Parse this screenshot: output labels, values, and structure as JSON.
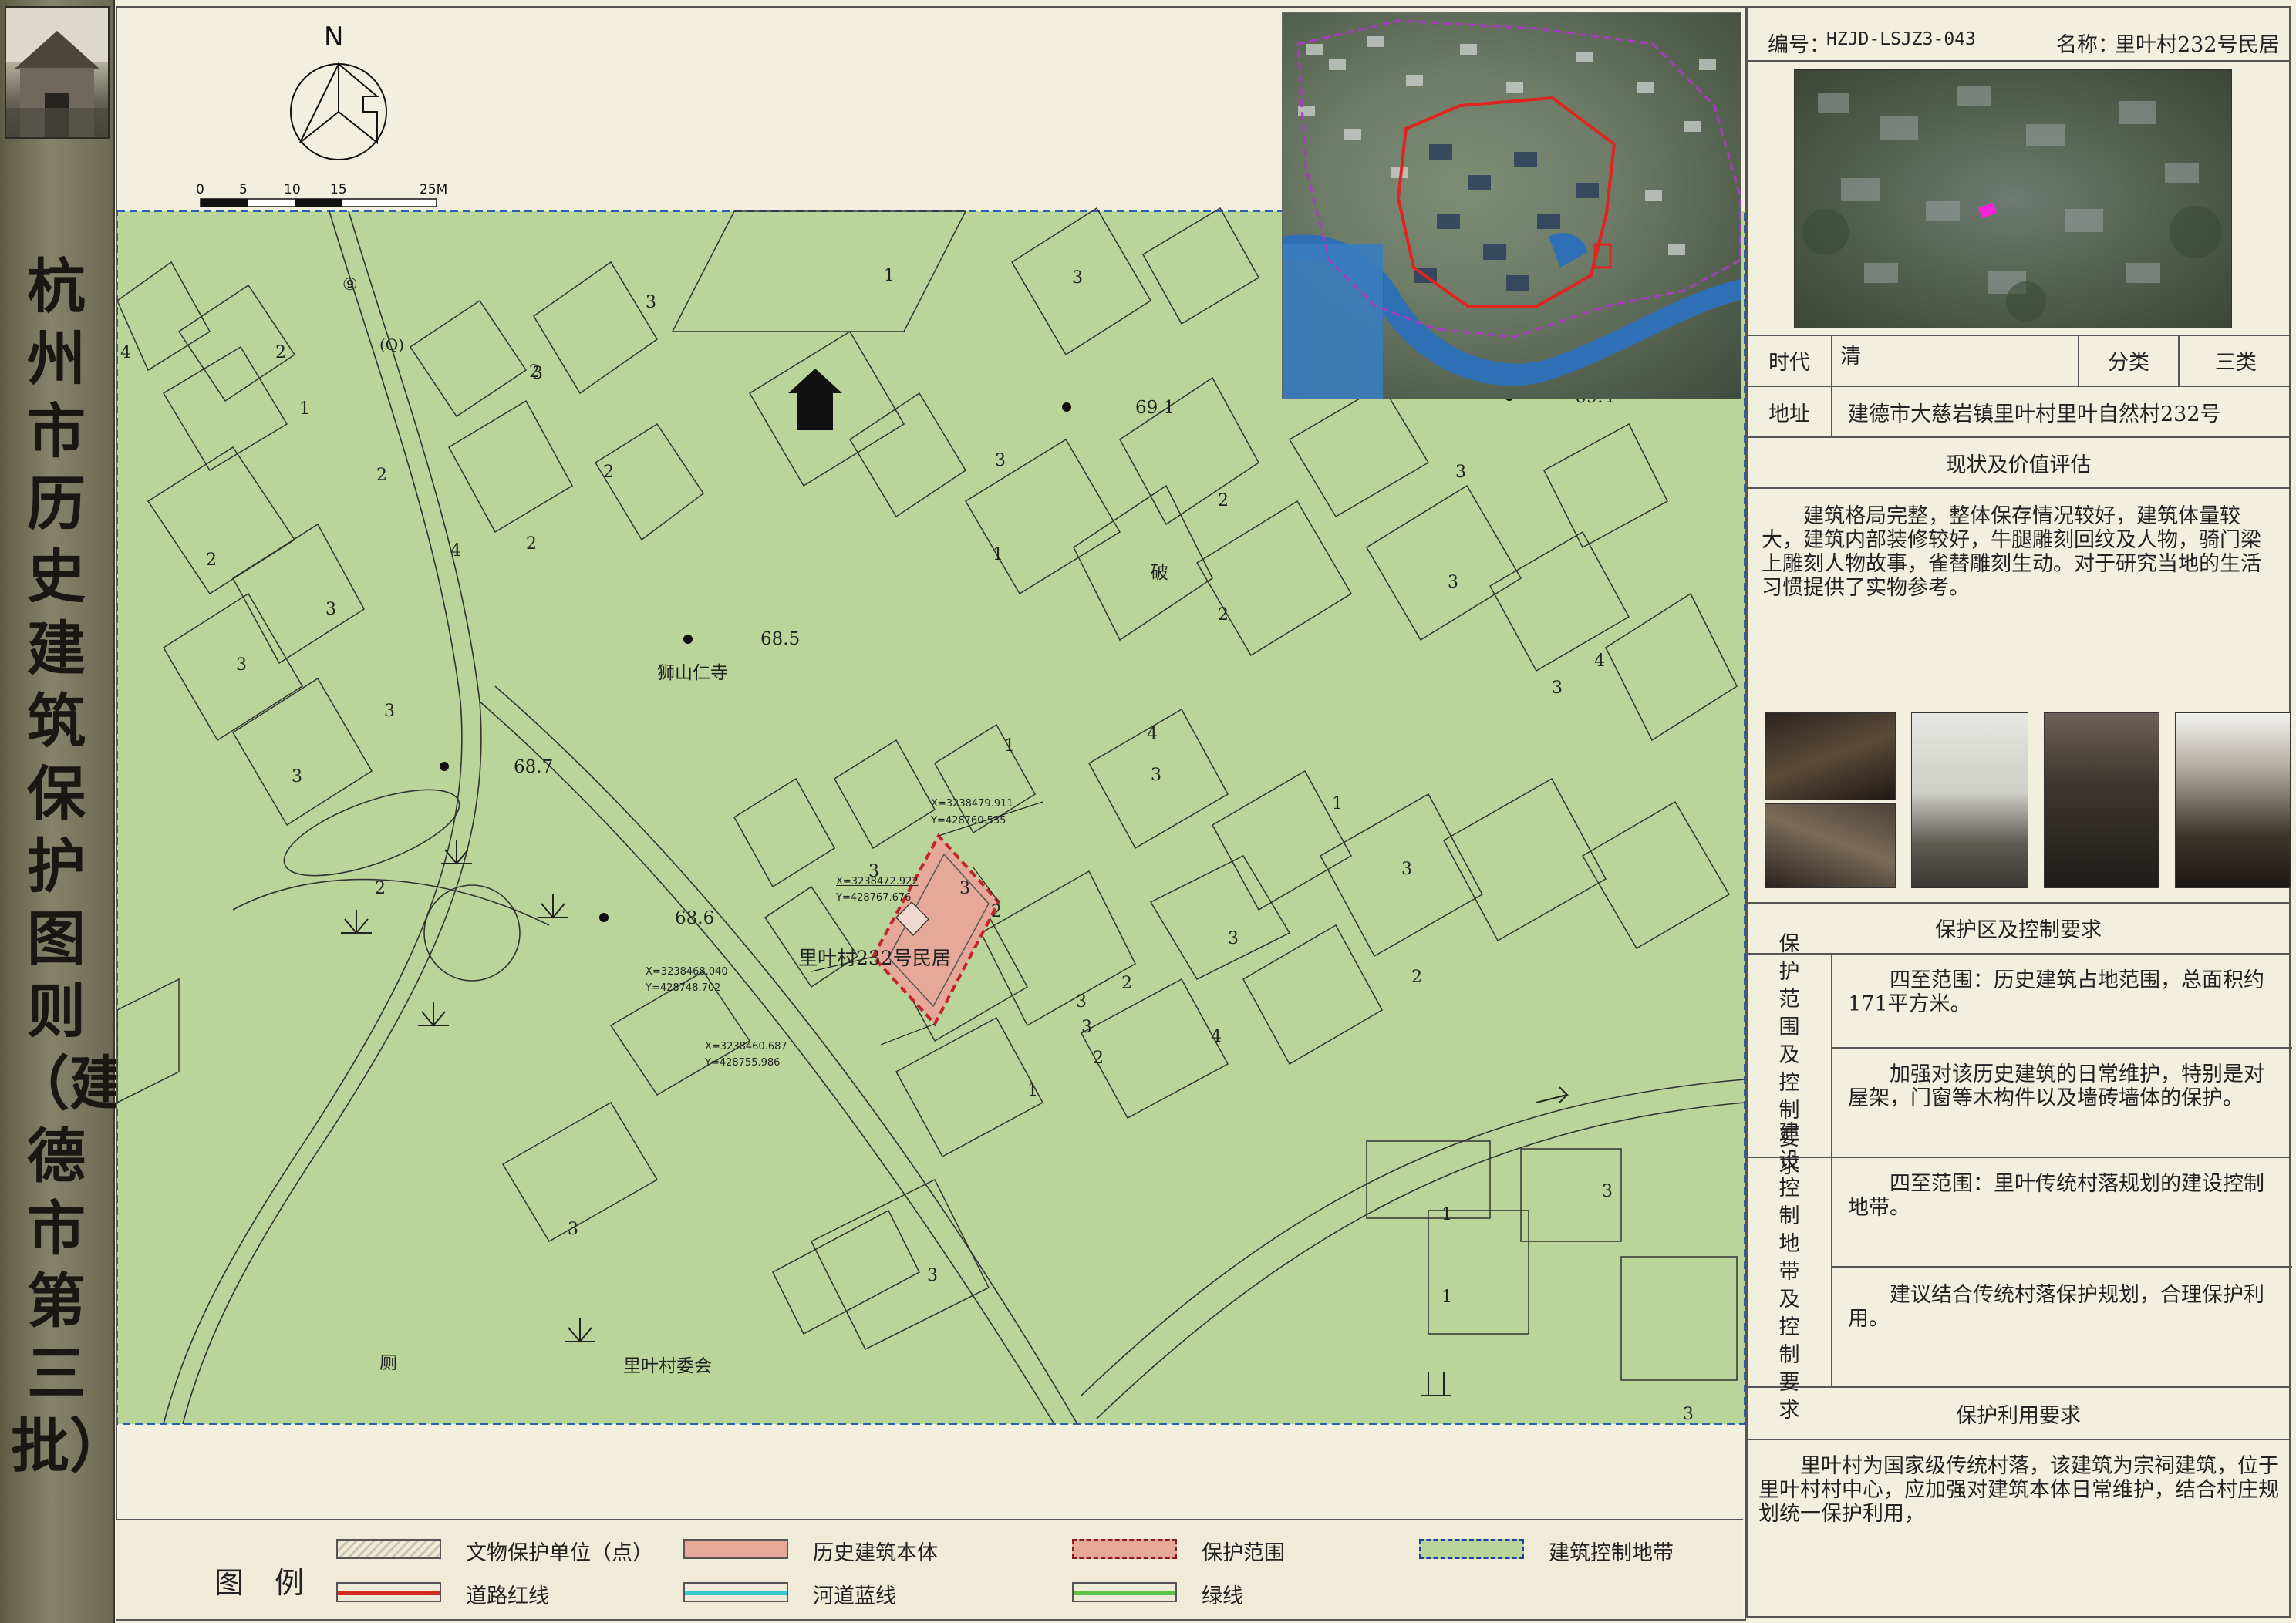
{
  "side_title": "杭州市历史建筑保护图则（建德市第三批）",
  "map": {
    "north": "N",
    "scale_ticks": [
      "0",
      "5",
      "10",
      "15",
      "25M"
    ],
    "main_building_label": "里叶村232号民居",
    "coords": [
      {
        "x": "X=3238479.911",
        "y": "Y=428760.535"
      },
      {
        "x": "X=3238472.922",
        "y": "Y=428767.676"
      },
      {
        "x": "X=3238468.040",
        "y": "Y=428748.702"
      },
      {
        "x": "X=3238460.687",
        "y": "Y=428755.986"
      }
    ],
    "place_labels": {
      "temple": "狮山仁寺",
      "village_committee": "里叶村委会",
      "broken": "破",
      "toilet": "厕"
    },
    "road_labels": [
      "⑨",
      "(Q)"
    ],
    "elevations": [
      "69.1",
      "68.5",
      "68.7",
      "68.6",
      "69.4"
    ],
    "building_floors": [
      "1",
      "2",
      "3",
      "4"
    ]
  },
  "legend": {
    "title": "图 例",
    "items": [
      {
        "label": "文物保护单位（点）",
        "color": "#c9c5b2"
      },
      {
        "label": "历史建筑本体",
        "color": "#e6a898"
      },
      {
        "label": "保护范围",
        "color": "#e6a898"
      },
      {
        "label": "建筑控制地带",
        "color": "#b9d59a"
      },
      {
        "label": "道路红线",
        "color": "#d42a24"
      },
      {
        "label": "河道蓝线",
        "color": "#36c9d4"
      },
      {
        "label": "绿线",
        "color": "#5bc446"
      }
    ]
  },
  "panel": {
    "code_label": "编号：",
    "code_value": "HZJD-LSJZ3-043",
    "name_label": "名称：",
    "name_value": "里叶村232号民居",
    "era_label": "时代",
    "era_value": "清",
    "class_label": "分类",
    "class_value": "三类",
    "address_label": "地址",
    "address_value": "建德市大慈岩镇里叶村里叶自然村232号",
    "status_heading": "现状及价值评估",
    "status_text": "建筑格局完整，整体保存情况较好，建筑体量较大，建筑内部装修较好，牛腿雕刻回纹及人物，骑门梁上雕刻人物故事，雀替雕刻生动。对于研究当地的生活习惯提供了实物参考。",
    "zone_heading": "保护区及控制要求",
    "protect_label": "保护范围及控制要求",
    "protect_range": "四至范围：历史建筑占地范围，总面积约171平方米。",
    "protect_req": "加强对该历史建筑的日常维护，特别是对屋架，门窗等木构件以及墙砖墙体的保护。",
    "control_label": "建设控制地带及控制要求",
    "control_range": "四至范围：里叶传统村落规划的建设控制地带。",
    "control_req": "建议结合传统村落保护规划，合理保护利用。",
    "use_heading": "保护利用要求",
    "use_text": "里叶村为国家级传统村落，该建筑为宗祠建筑，位于里叶村村中心，应加强对建筑本体日常维护，结合村庄规划统一保护利用，"
  }
}
